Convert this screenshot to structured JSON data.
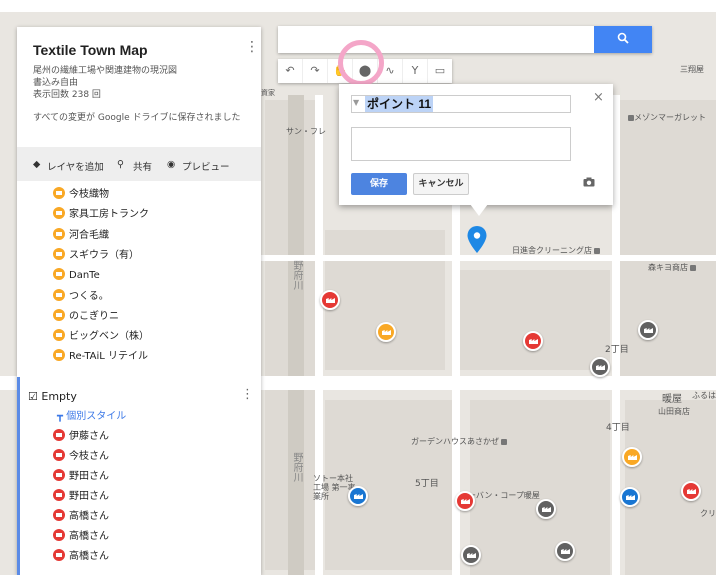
{
  "search": {
    "button_icon": "search-icon"
  },
  "toolbar": {
    "tools": [
      "undo-icon",
      "redo-icon",
      "hand-icon",
      "marker-icon",
      "line-icon",
      "directions-icon",
      "ruler-icon"
    ],
    "tool_glyphs": [
      "↶",
      "↷",
      "✋",
      "⬤",
      "∿",
      "Y",
      "▭"
    ]
  },
  "panel": {
    "title": "Textile Town Map",
    "menu_glyph": "⋮",
    "description": "尾州の繊維工場や関連建物の現況図",
    "edit_status": "書込み自由",
    "view_count": "表示回数 238 回",
    "saved_note": "すべての変更が Google ドライブに保存されました",
    "actions": {
      "add_layer": "レイヤを追加",
      "share": "共有",
      "preview": "プレビュー"
    },
    "layer1_items": [
      {
        "label": "今枝織物",
        "color": "yellow"
      },
      {
        "label": "家具工房トランク",
        "color": "yellow"
      },
      {
        "label": "河合毛織",
        "color": "yellow"
      },
      {
        "label": "スギウラ（有）",
        "color": "yellow"
      },
      {
        "label": "DanTe",
        "color": "yellow"
      },
      {
        "label": "つくる。",
        "color": "yellow"
      },
      {
        "label": "のこぎりニ",
        "color": "yellow"
      },
      {
        "label": "ビッグベン（株）",
        "color": "yellow"
      },
      {
        "label": "Re-TAiL リテイル",
        "color": "yellow"
      }
    ],
    "layer2": {
      "title": "Empty",
      "style_link": "個別スタイル",
      "items": [
        {
          "label": "伊藤さん",
          "color": "red"
        },
        {
          "label": "今枝さん",
          "color": "red"
        },
        {
          "label": "野田さん",
          "color": "red"
        },
        {
          "label": "野田さん",
          "color": "red"
        },
        {
          "label": "高橋さん",
          "color": "red"
        },
        {
          "label": "高橋さん",
          "color": "red"
        },
        {
          "label": "高橋さん",
          "color": "red"
        }
      ]
    }
  },
  "popup": {
    "title_value": "ポイント 11",
    "save_label": "保存",
    "cancel_label": "キャンセル",
    "close_glyph": "×",
    "camera_glyph": "📷"
  },
  "map_labels": {
    "cleaning": "日進舎クリーニング店",
    "morikiyo": "森キヨ商店",
    "garden": "ガーデンハウスあさかぜ",
    "chome2": "2丁目",
    "chome4": "4丁目",
    "chome5": "5丁目",
    "yamada": "山田商店",
    "coop": "ユーバン・コープ暖屋",
    "factory": "ソトー本社工場 第一事業所",
    "river1": "野府川",
    "river2": "野府川",
    "sanpo": "サン・フレ",
    "mezon": "メゾンマーガレット",
    "sanko": "三翔屋",
    "danya": "暖屋",
    "furuwa": "ふるは",
    "kuri": "クリ",
    "kaz": "資家"
  },
  "colors": {
    "accent": "#4285f4",
    "highlight_ring": "#f4a6c8"
  }
}
